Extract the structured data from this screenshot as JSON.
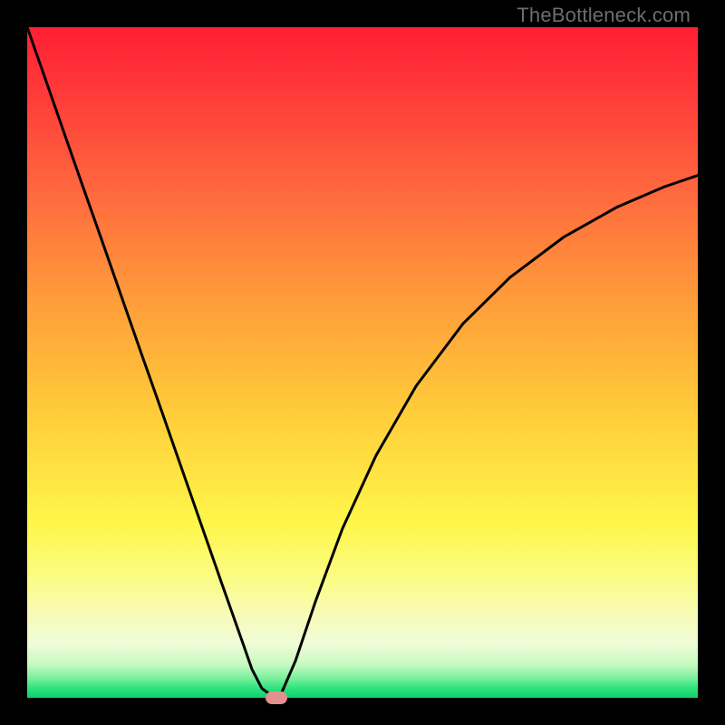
{
  "watermark": "TheBottleneck.com",
  "colors": {
    "frame": "#000000",
    "gradient_top": "#ff1e33",
    "gradient_bottom": "#0ecf6b",
    "curve": "#000000",
    "marker": "#e39091"
  },
  "chart_data": {
    "type": "line",
    "title": "",
    "xlabel": "",
    "ylabel": "",
    "xlim": [
      0,
      100
    ],
    "ylim": [
      0,
      100
    ],
    "x": [
      0,
      2,
      5,
      8,
      11,
      14,
      17,
      20,
      23,
      26,
      29,
      32,
      33.5,
      35,
      36.5,
      37.2,
      38,
      40,
      43,
      47,
      52,
      58,
      65,
      72,
      80,
      88,
      95,
      100
    ],
    "values": [
      100,
      94.3,
      85.7,
      77.1,
      68.6,
      60.0,
      51.4,
      42.9,
      34.3,
      25.7,
      17.1,
      8.6,
      4.3,
      1.4,
      0.3,
      0.0,
      0.9,
      5.5,
      14.4,
      25.2,
      36.1,
      46.5,
      55.8,
      62.7,
      68.7,
      73.2,
      76.2,
      77.9
    ],
    "marker": {
      "x": 37.2,
      "y": 0.0
    },
    "grid": false,
    "legend": false
  }
}
